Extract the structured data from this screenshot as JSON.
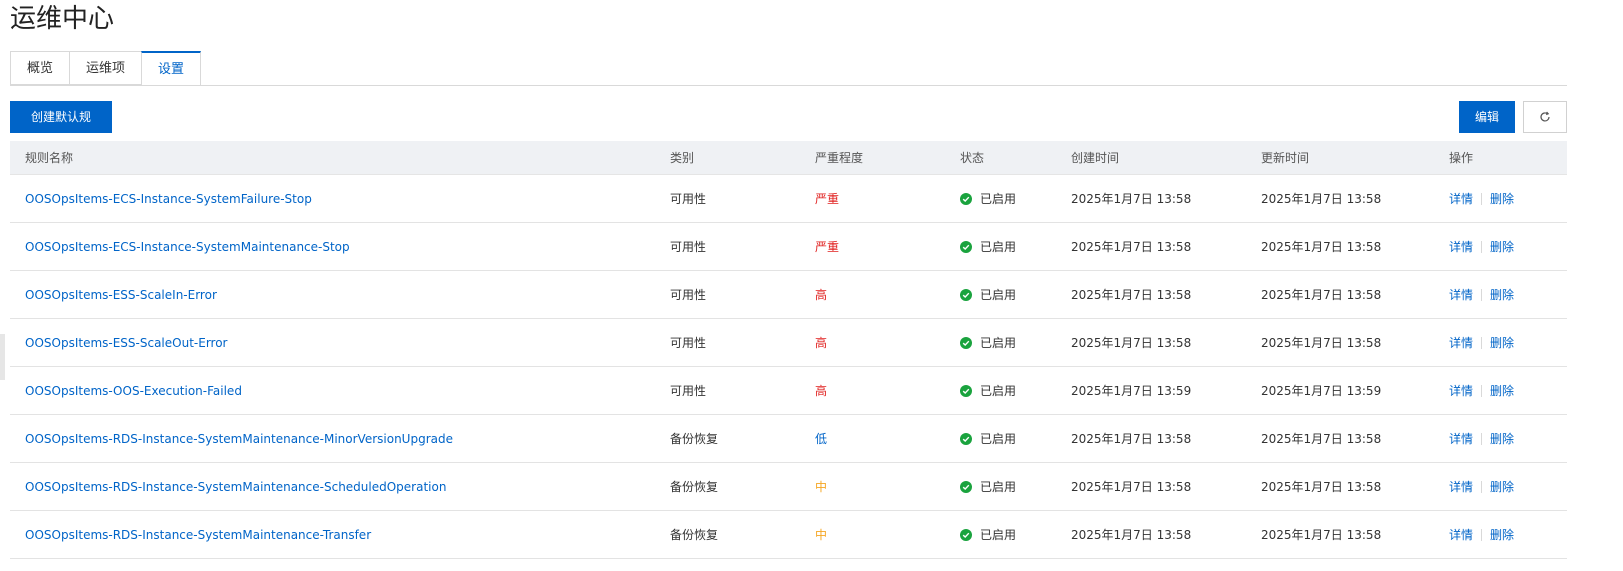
{
  "page": {
    "title": "运维中心"
  },
  "tabs": [
    {
      "label": "概览",
      "active": false
    },
    {
      "label": "运维项",
      "active": false
    },
    {
      "label": "设置",
      "active": true
    }
  ],
  "toolbar": {
    "create_label": "创建默认规则",
    "edit_label": "编辑",
    "refresh_icon": "refresh-icon"
  },
  "table": {
    "headers": {
      "name": "规则名称",
      "category": "类别",
      "severity": "严重程度",
      "status": "状态",
      "created": "创建时间",
      "updated": "更新时间",
      "ops": "操作"
    },
    "rows": [
      {
        "name": "OOSOpsItems-ECS-Instance-SystemFailure-Stop",
        "category": "可用性",
        "severity": "严重",
        "sev_color": "#e0201f",
        "status": "已启用",
        "created": "2025年1月7日 13:58",
        "updated": "2025年1月7日 13:58",
        "detail": "详情",
        "delete": "删除"
      },
      {
        "name": "OOSOpsItems-ECS-Instance-SystemMaintenance-Stop",
        "category": "可用性",
        "severity": "严重",
        "sev_color": "#e0201f",
        "status": "已启用",
        "created": "2025年1月7日 13:58",
        "updated": "2025年1月7日 13:58",
        "detail": "详情",
        "delete": "删除"
      },
      {
        "name": "OOSOpsItems-ESS-ScaleIn-Error",
        "category": "可用性",
        "severity": "高",
        "sev_color": "#e0201f",
        "status": "已启用",
        "created": "2025年1月7日 13:58",
        "updated": "2025年1月7日 13:58",
        "detail": "详情",
        "delete": "删除"
      },
      {
        "name": "OOSOpsItems-ESS-ScaleOut-Error",
        "category": "可用性",
        "severity": "高",
        "sev_color": "#e0201f",
        "status": "已启用",
        "created": "2025年1月7日 13:58",
        "updated": "2025年1月7日 13:58",
        "detail": "详情",
        "delete": "删除"
      },
      {
        "name": "OOSOpsItems-OOS-Execution-Failed",
        "category": "可用性",
        "severity": "高",
        "sev_color": "#e0201f",
        "status": "已启用",
        "created": "2025年1月7日 13:59",
        "updated": "2025年1月7日 13:59",
        "detail": "详情",
        "delete": "删除"
      },
      {
        "name": "OOSOpsItems-RDS-Instance-SystemMaintenance-MinorVersionUpgrade",
        "category": "备份恢复",
        "severity": "低",
        "sev_color": "#0064c8",
        "status": "已启用",
        "created": "2025年1月7日 13:58",
        "updated": "2025年1月7日 13:58",
        "detail": "详情",
        "delete": "删除"
      },
      {
        "name": "OOSOpsItems-RDS-Instance-SystemMaintenance-ScheduledOperation",
        "category": "备份恢复",
        "severity": "中",
        "sev_color": "#f5a623",
        "status": "已启用",
        "created": "2025年1月7日 13:58",
        "updated": "2025年1月7日 13:58",
        "detail": "详情",
        "delete": "删除"
      },
      {
        "name": "OOSOpsItems-RDS-Instance-SystemMaintenance-Transfer",
        "category": "备份恢复",
        "severity": "中",
        "sev_color": "#f5a623",
        "status": "已启用",
        "created": "2025年1月7日 13:58",
        "updated": "2025年1月7日 13:58",
        "detail": "详情",
        "delete": "删除"
      }
    ]
  },
  "colors": {
    "primary": "#0064c8",
    "status_ok": "#1aa33e",
    "header_bg": "#eff1f4"
  }
}
